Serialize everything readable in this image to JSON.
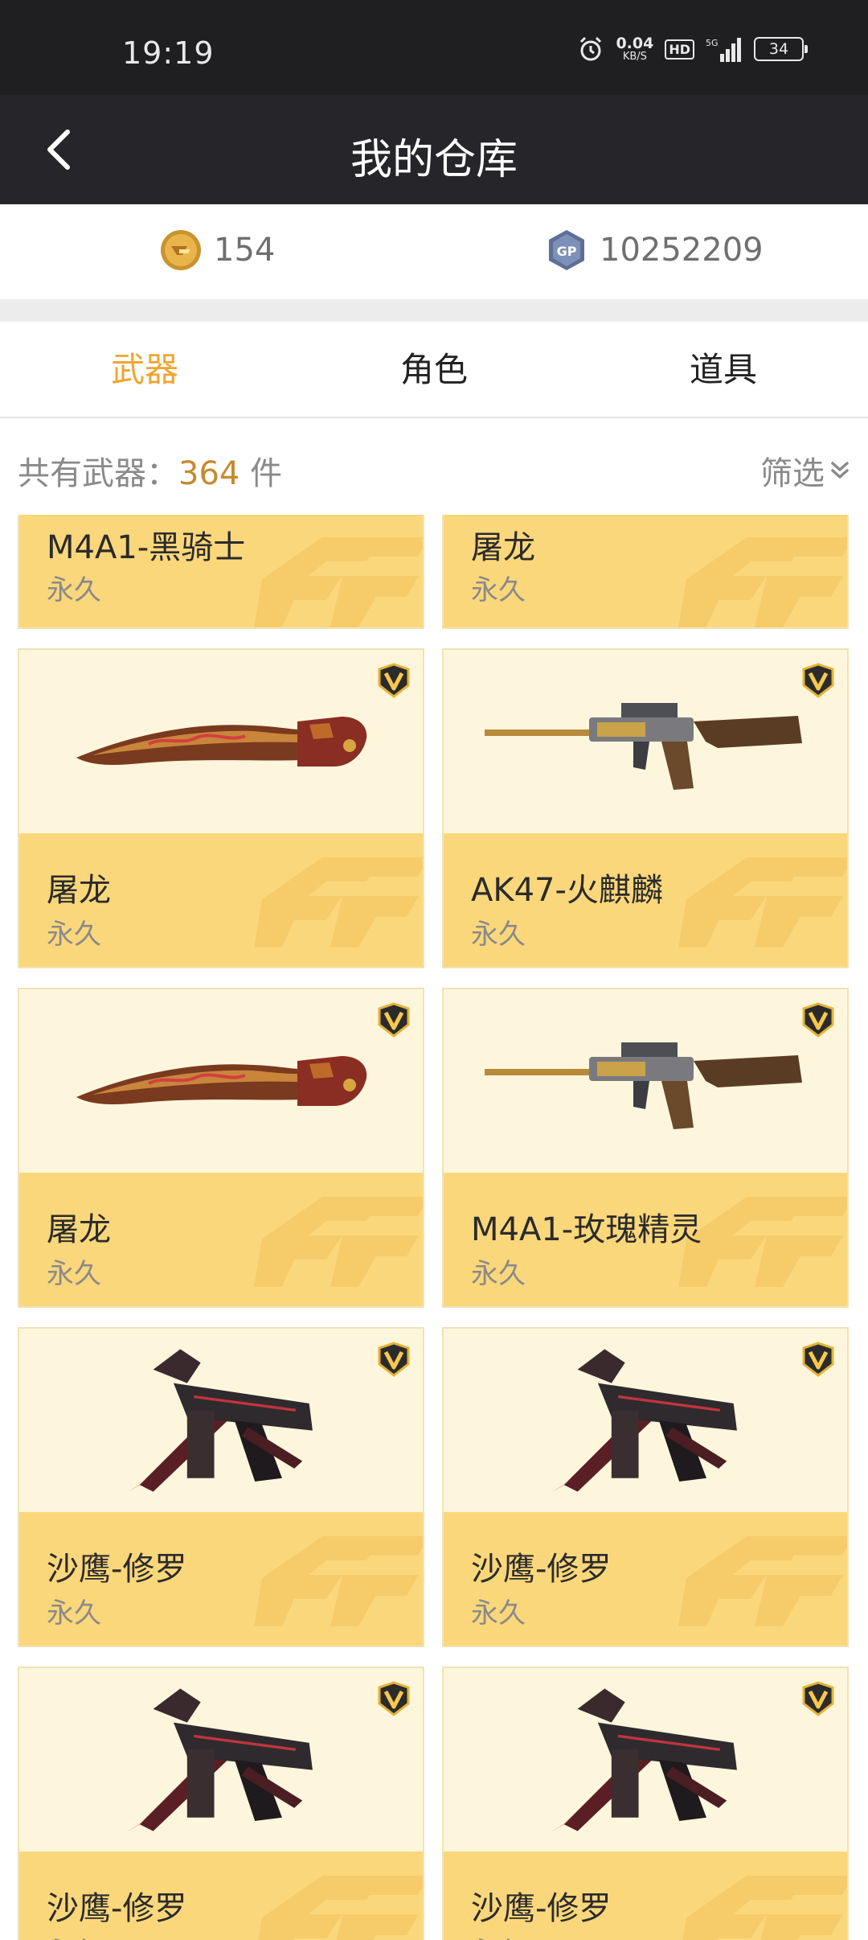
{
  "status_bar": {
    "time": "19:19",
    "net_speed": "0.04",
    "net_unit": "KB/S",
    "hd": "HD",
    "signal": "5G",
    "battery": "34"
  },
  "header": {
    "title": "我的仓库"
  },
  "currency": {
    "cf_points": "154",
    "gp": "10252209"
  },
  "tabs": [
    {
      "label": "武器",
      "active": true
    },
    {
      "label": "角色",
      "active": false
    },
    {
      "label": "道具",
      "active": false
    }
  ],
  "summary": {
    "prefix": "共有武器：",
    "count": "364",
    "suffix": " 件",
    "filter_label": "筛选"
  },
  "items": [
    {
      "name": "M4A1-黑骑士",
      "duration": "永久",
      "weapon": "rifle-icon"
    },
    {
      "name": "屠龙",
      "duration": "永久",
      "weapon": "knife-icon"
    },
    {
      "name": "屠龙",
      "duration": "永久",
      "weapon": "knife-icon"
    },
    {
      "name": "AK47-火麒麟",
      "duration": "永久",
      "weapon": "rifle-icon"
    },
    {
      "name": "屠龙",
      "duration": "永久",
      "weapon": "knife-icon"
    },
    {
      "name": "M4A1-玫瑰精灵",
      "duration": "永久",
      "weapon": "rifle-icon"
    },
    {
      "name": "沙鹰-修罗",
      "duration": "永久",
      "weapon": "pistol-icon"
    },
    {
      "name": "沙鹰-修罗",
      "duration": "永久",
      "weapon": "pistol-icon"
    },
    {
      "name": "沙鹰-修罗",
      "duration": "永久",
      "weapon": "pistol-icon"
    },
    {
      "name": "沙鹰-修罗",
      "duration": "永久",
      "weapon": "pistol-icon"
    }
  ],
  "colors": {
    "accent": "#f0a531",
    "card_label_bg": "#fbd77b",
    "card_image_bg": "#fef6dc",
    "header_bg": "#26262a"
  }
}
